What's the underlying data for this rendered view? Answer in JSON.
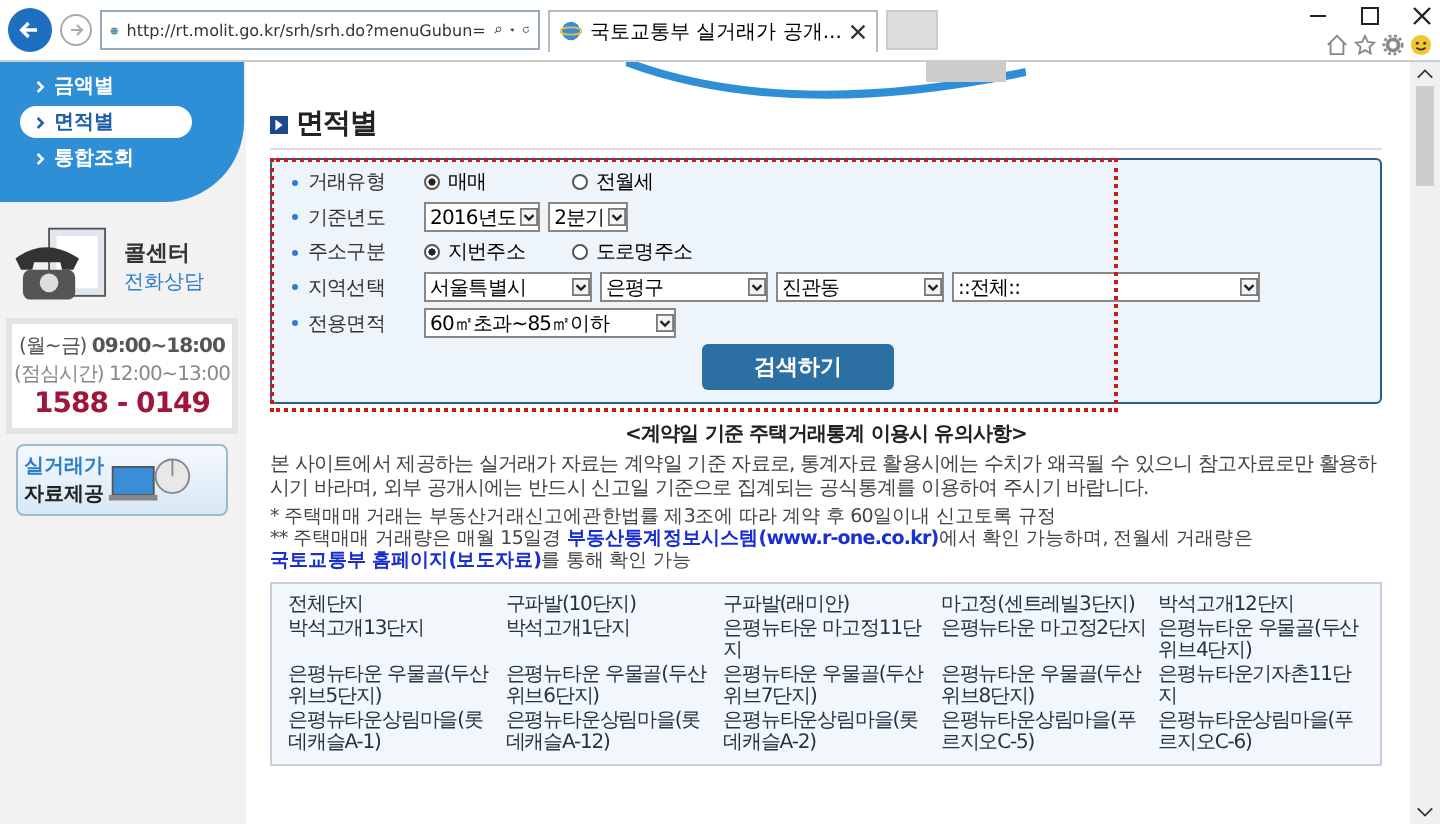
{
  "browser": {
    "url": "http://rt.molit.go.kr/srh/srh.do?menuGubun=",
    "tab_title": "국토교통부 실거래가 공개..."
  },
  "sidebar": {
    "menu": [
      {
        "label": "금액별",
        "selected": false
      },
      {
        "label": "면적별",
        "selected": true
      },
      {
        "label": "통합조회",
        "selected": false
      }
    ],
    "call_center": {
      "title": "콜센터",
      "subtitle": "전화상담",
      "hours": "(월~금) **09:00~18:00**",
      "lunch": "(점심시간) 12:00~13:00",
      "phone": "1588 - 0149"
    },
    "data_banner": {
      "line1": "실거래가",
      "line2": "자료제공"
    }
  },
  "page_title": "면적별",
  "form": {
    "rows": [
      {
        "label": "거래유형",
        "kind": "radio",
        "options": [
          {
            "label": "매매",
            "selected": true
          },
          {
            "label": "전월세",
            "selected": false
          }
        ]
      },
      {
        "label": "기준년도",
        "kind": "select",
        "selects": [
          "2016년도",
          "2분기"
        ]
      },
      {
        "label": "주소구분",
        "kind": "radio",
        "options": [
          {
            "label": "지번주소",
            "selected": true
          },
          {
            "label": "도로명주소",
            "selected": false
          }
        ]
      },
      {
        "label": "지역선택",
        "kind": "select",
        "selects": [
          "서울특별시",
          "은평구",
          "진관동",
          "::전체::"
        ]
      },
      {
        "label": "전용면적",
        "kind": "select",
        "selects": [
          "60㎡초과~85㎡이하"
        ]
      }
    ],
    "button": "검색하기"
  },
  "notice": {
    "title": "<계약일 기준 주택거래통계 이용시 유의사항>",
    "paragraph": "본 사이트에서 제공하는 실거래가 자료는 계약일 기준 자료로, 통계자료 활용시에는 수치가 왜곡될 수 있으니 참고자료로만 활용하시기 바라며, 외부 공개시에는 반드시 신고일 기준으로 집계되는 공식통계를 이용하여 주시기 바랍니다.",
    "bullets": [
      [
        {
          "text": "* 주택매매 거래는 부동산거래신고에관한법률 제3조에 따라 계약 후 60일이내 신고토록 규정",
          "link": false
        }
      ],
      [
        {
          "text": "** 주택매매 거래량은 매월 15일경 ",
          "link": false
        },
        {
          "text": "부동산통계정보시스템(www.r-one.co.kr)",
          "link": true
        },
        {
          "text": "에서 확인 가능하며, 전월세 거래량은 ",
          "link": false
        },
        {
          "text": "국토교통부 홈페이지(보도자료)",
          "link": true
        },
        {
          "text": "를 통해 확인 가능",
          "link": false
        }
      ]
    ]
  },
  "complexes": [
    "전체단지",
    "구파발(10단지)",
    "구파발(래미안)",
    "마고정(센트레빌3단지)",
    "박석고개12단지",
    "박석고개13단지",
    "박석고개1단지",
    "은평뉴타운 마고정11단지",
    "은평뉴타운 마고정2단지",
    "은평뉴타운 우물골(두산위브4단지)",
    "은평뉴타운 우물골(두산위브5단지)",
    "은평뉴타운 우물골(두산위브6단지)",
    "은평뉴타운 우물골(두산위브7단지)",
    "은평뉴타운 우물골(두산위브8단지)",
    "은평뉴타운기자촌11단지",
    "은평뉴타운상림마을(롯데캐슬A-1)",
    "은평뉴타운상림마을(롯데캐슬A-12)",
    "은평뉴타운상림마을(롯데캐슬A-2)",
    "은평뉴타운상림마을(푸르지오C-5)",
    "은평뉴타운상림마을(푸르지오C-6)"
  ]
}
